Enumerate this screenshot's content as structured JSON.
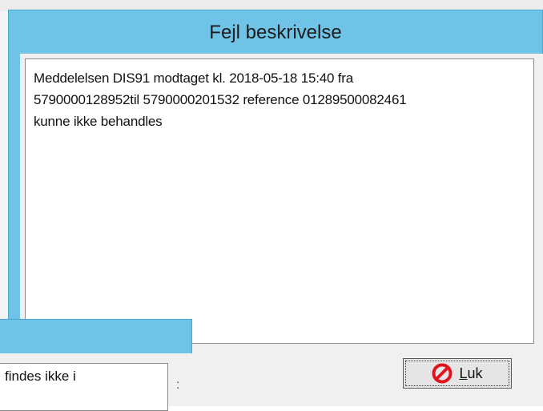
{
  "main_dialog": {
    "title": "Fejl beskrivelse",
    "message": "Meddelelsen DIS91 modtaget kl. 2018-05-18 15:40 fra\n5790000128952til 5790000201532 reference 01289500082461\nkunne ikke behandles",
    "close_button": {
      "icon": "no-entry-icon",
      "label_first": "L",
      "label_rest": "uk"
    }
  },
  "secondary_dialog": {
    "field_text": "findes ikke i",
    "mark": ":"
  },
  "colors": {
    "titlebar": "#6fc3e6",
    "window_body": "#f0f0f0",
    "icon_red": "#e0141e"
  }
}
